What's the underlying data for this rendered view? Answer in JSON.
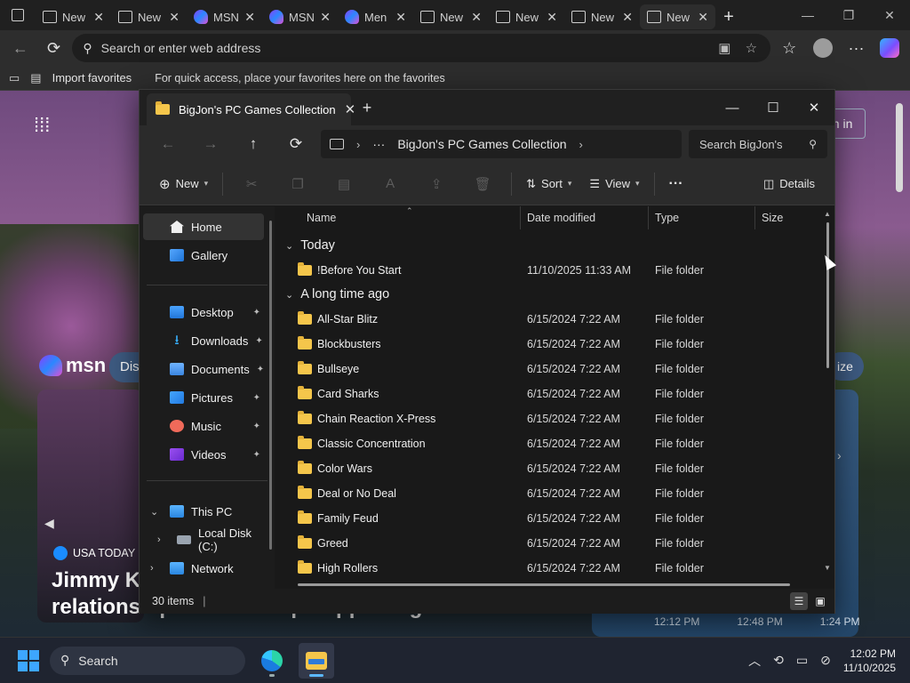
{
  "browser": {
    "tabs": [
      {
        "label": "New",
        "icon": "page-icon",
        "active": false
      },
      {
        "label": "New",
        "icon": "page-icon",
        "active": false
      },
      {
        "label": "MSN",
        "icon": "msn-icon",
        "active": false
      },
      {
        "label": "MSN",
        "icon": "msn-icon",
        "active": false
      },
      {
        "label": "Men",
        "icon": "msn-icon",
        "active": false
      },
      {
        "label": "New",
        "icon": "page-icon",
        "active": false
      },
      {
        "label": "New",
        "icon": "page-icon",
        "active": false
      },
      {
        "label": "New",
        "icon": "page-icon",
        "active": false
      },
      {
        "label": "New",
        "icon": "page-icon",
        "active": true
      }
    ],
    "address_placeholder": "Search or enter web address",
    "favorites": {
      "import_label": "Import favorites",
      "hint": "For quick access, place your favorites here on the favorites"
    }
  },
  "msn": {
    "logo": "msn",
    "discover_partial": "Dis",
    "sign_in_partial": "gn in",
    "personalize_partial": "ize",
    "source": "USA TODAY",
    "headline_line1": "Jimmy Ki",
    "headline_line2": "relationships with Trump-supporting families",
    "times": [
      "12:12 PM",
      "12:48 PM",
      "1:24 PM"
    ]
  },
  "explorer": {
    "tab_title": "BigJon's PC Games Collection",
    "breadcrumb": {
      "more": "···",
      "current": "BigJon's PC Games Collection"
    },
    "search_placeholder": "Search BigJon's",
    "toolbar": {
      "new_label": "New",
      "sort_label": "Sort",
      "view_label": "View",
      "more_label": "···",
      "details_label": "Details"
    },
    "sidebar": {
      "home": "Home",
      "gallery": "Gallery",
      "desktop": "Desktop",
      "downloads": "Downloads",
      "documents": "Documents",
      "pictures": "Pictures",
      "music": "Music",
      "videos": "Videos",
      "this_pc": "This PC",
      "local_disk": "Local Disk (C:)",
      "network": "Network"
    },
    "columns": {
      "name": "Name",
      "date": "Date modified",
      "type": "Type",
      "size": "Size"
    },
    "groups": {
      "today": "Today",
      "long_ago": "A long time ago"
    },
    "rows_today": [
      {
        "name": "!Before You Start",
        "date": "11/10/2025 11:33 AM",
        "type": "File folder"
      }
    ],
    "rows_old": [
      {
        "name": "All-Star Blitz",
        "date": "6/15/2024 7:22 AM",
        "type": "File folder"
      },
      {
        "name": "Blockbusters",
        "date": "6/15/2024 7:22 AM",
        "type": "File folder"
      },
      {
        "name": "Bullseye",
        "date": "6/15/2024 7:22 AM",
        "type": "File folder"
      },
      {
        "name": "Card Sharks",
        "date": "6/15/2024 7:22 AM",
        "type": "File folder"
      },
      {
        "name": "Chain Reaction X-Press",
        "date": "6/15/2024 7:22 AM",
        "type": "File folder"
      },
      {
        "name": "Classic Concentration",
        "date": "6/15/2024 7:22 AM",
        "type": "File folder"
      },
      {
        "name": "Color Wars",
        "date": "6/15/2024 7:22 AM",
        "type": "File folder"
      },
      {
        "name": "Deal or No Deal",
        "date": "6/15/2024 7:22 AM",
        "type": "File folder"
      },
      {
        "name": "Family Feud",
        "date": "6/15/2024 7:22 AM",
        "type": "File folder"
      },
      {
        "name": "Greed",
        "date": "6/15/2024 7:22 AM",
        "type": "File folder"
      },
      {
        "name": "High Rollers",
        "date": "6/15/2024 7:22 AM",
        "type": "File folder"
      }
    ],
    "status": "30 items"
  },
  "taskbar": {
    "search_placeholder": "Search",
    "time": "12:02 PM",
    "date": "11/10/2025"
  },
  "colors": {
    "folder": "#f5c64b",
    "accent": "#3da6ff"
  }
}
